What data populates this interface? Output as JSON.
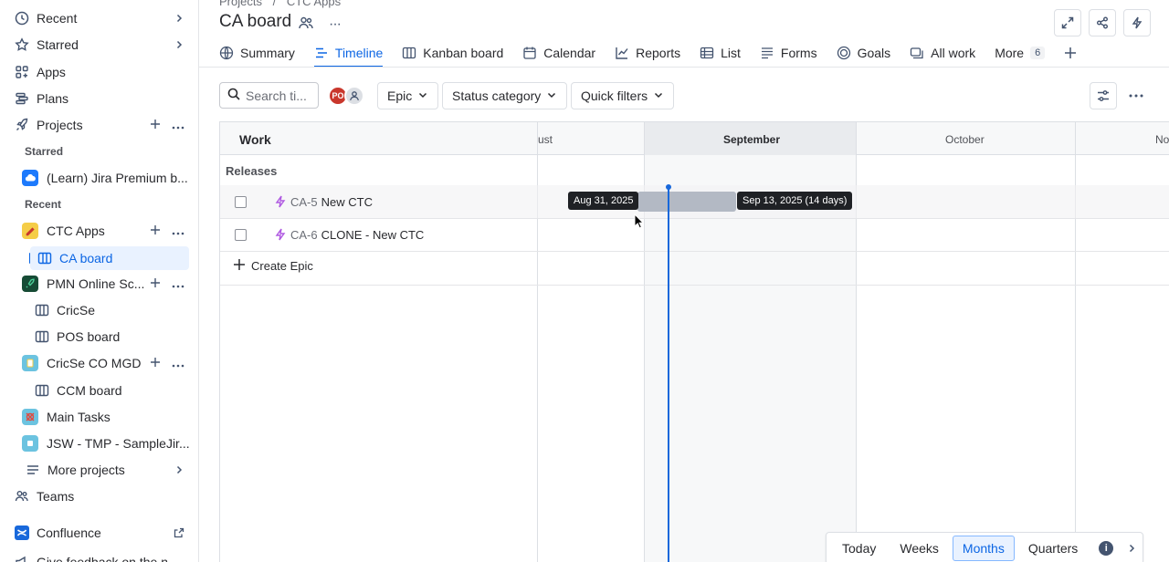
{
  "sidebar": {
    "recent": "Recent",
    "starred": "Starred",
    "apps": "Apps",
    "plans": "Plans",
    "projects": "Projects",
    "section_starred": "Starred",
    "learn_project": "(Learn) Jira Premium b...",
    "section_recent": "Recent",
    "ctc_apps": "CTC Apps",
    "ca_board": "CA board",
    "pmn": "PMN Online Sc...",
    "cricse": "CricSe",
    "pos_board": "POS board",
    "cricse_co": "CricSe CO MGD",
    "ccm_board": "CCM board",
    "main_tasks": "Main Tasks",
    "jsw": "JSW - TMP - SampleJir...",
    "more_projects": "More projects",
    "teams": "Teams",
    "confluence": "Confluence",
    "feedback": "Give feedback on the n..."
  },
  "header": {
    "breadcrumb_root": "Projects",
    "breadcrumb_sep": "/",
    "breadcrumb_project": "CTC Apps",
    "title": "CA board",
    "more": "···"
  },
  "tabs": [
    {
      "label": "Summary",
      "icon": "globe-icon"
    },
    {
      "label": "Timeline",
      "icon": "timeline-icon"
    },
    {
      "label": "Kanban board",
      "icon": "board-icon"
    },
    {
      "label": "Calendar",
      "icon": "calendar-icon"
    },
    {
      "label": "Reports",
      "icon": "chart-icon"
    },
    {
      "label": "List",
      "icon": "list-icon"
    },
    {
      "label": "Forms",
      "icon": "forms-icon"
    },
    {
      "label": "Goals",
      "icon": "goal-icon"
    },
    {
      "label": "All work",
      "icon": "all-work-icon"
    },
    {
      "label": "More",
      "icon": ""
    }
  ],
  "more_count": "6",
  "toolbar": {
    "search_placeholder": "Search ti...",
    "avatar_initials": "PO",
    "epic": "Epic",
    "status_category": "Status category",
    "quick_filters": "Quick filters"
  },
  "timeline": {
    "work_header": "Work",
    "months": [
      "ust",
      "September",
      "October",
      "No"
    ],
    "releases": "Releases",
    "rows": [
      {
        "key": "CA-5",
        "summary": "New CTC"
      },
      {
        "key": "CA-6",
        "summary": "CLONE - New CTC"
      }
    ],
    "create_epic": "Create Epic",
    "tip_start": "Aug 31, 2025",
    "tip_end": "Sep 13, 2025 (14 days)"
  },
  "zoom": {
    "today": "Today",
    "weeks": "Weeks",
    "months": "Months",
    "quarters": "Quarters",
    "info": "i"
  },
  "colors": {
    "accent": "#0c66e4",
    "today_line": "#1868db",
    "epic": "#af59e1",
    "avatar": "#c9372c"
  }
}
